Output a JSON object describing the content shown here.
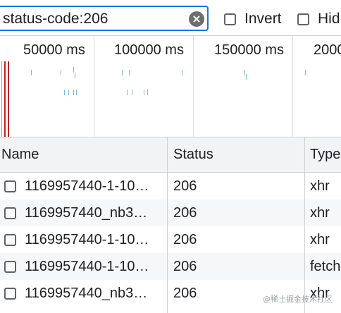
{
  "filter": {
    "value": "status-code:206",
    "clear_icon": "×",
    "invert_label": "Invert",
    "hide_label": "Hid"
  },
  "timeline": {
    "ticks": [
      "50000 ms",
      "100000 ms",
      "150000 ms",
      "2000"
    ]
  },
  "table": {
    "headers": {
      "name": "Name",
      "status": "Status",
      "type": "Type"
    },
    "rows": [
      {
        "name": "1169957440-1-10…",
        "status": "206",
        "type": "xhr"
      },
      {
        "name": "1169957440_nb3…",
        "status": "206",
        "type": "xhr"
      },
      {
        "name": "1169957440-1-10…",
        "status": "206",
        "type": "xhr"
      },
      {
        "name": "1169957440-1-10…",
        "status": "206",
        "type": "fetch"
      },
      {
        "name": "1169957440_nb3…",
        "status": "206",
        "type": "xhr"
      }
    ]
  },
  "watermark": "@稀土掘金技术社区"
}
